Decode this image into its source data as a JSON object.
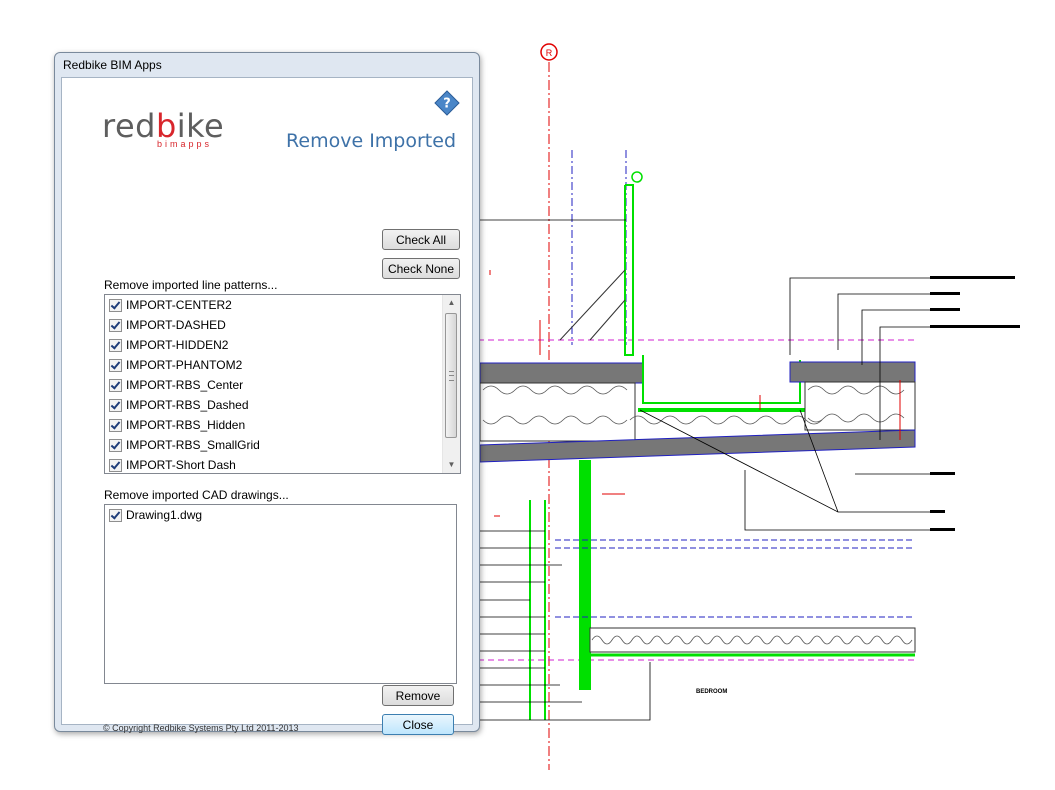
{
  "window": {
    "title": "Redbike BIM Apps"
  },
  "logo": {
    "main_pre": "red",
    "main_accent": "b",
    "main_post": "ike",
    "sub": "bimapps"
  },
  "header": {
    "app_title": "Remove Imported",
    "help_icon": "question-icon"
  },
  "buttons": {
    "check_all": "Check All",
    "check_none": "Check None",
    "remove": "Remove",
    "close": "Close"
  },
  "line_patterns": {
    "label": "Remove imported line patterns...",
    "items": [
      {
        "label": "IMPORT-CENTER2",
        "checked": true
      },
      {
        "label": "IMPORT-DASHED",
        "checked": true
      },
      {
        "label": "IMPORT-HIDDEN2",
        "checked": true
      },
      {
        "label": "IMPORT-PHANTOM2",
        "checked": true
      },
      {
        "label": "IMPORT-RBS_Center",
        "checked": true
      },
      {
        "label": "IMPORT-RBS_Dashed",
        "checked": true
      },
      {
        "label": "IMPORT-RBS_Hidden",
        "checked": true
      },
      {
        "label": "IMPORT-RBS_SmallGrid",
        "checked": true
      },
      {
        "label": "IMPORT-Short Dash",
        "checked": true
      }
    ]
  },
  "cad_drawings": {
    "label": "Remove imported CAD drawings...",
    "items": [
      {
        "label": "Drawing1.dwg",
        "checked": true
      }
    ]
  },
  "footer": {
    "copyright": "© Copyright Redbike Systems Pty Ltd 2011-2013"
  },
  "drawing": {
    "grid_bubble": "R",
    "room_label": "BEDROOM"
  },
  "colors": {
    "brand_red": "#d8262c",
    "title_blue": "#3e72a8",
    "cad_green": "#00e000",
    "cad_magenta": "#d020d0",
    "cad_blue": "#2020c0",
    "cad_red": "#e00000"
  }
}
